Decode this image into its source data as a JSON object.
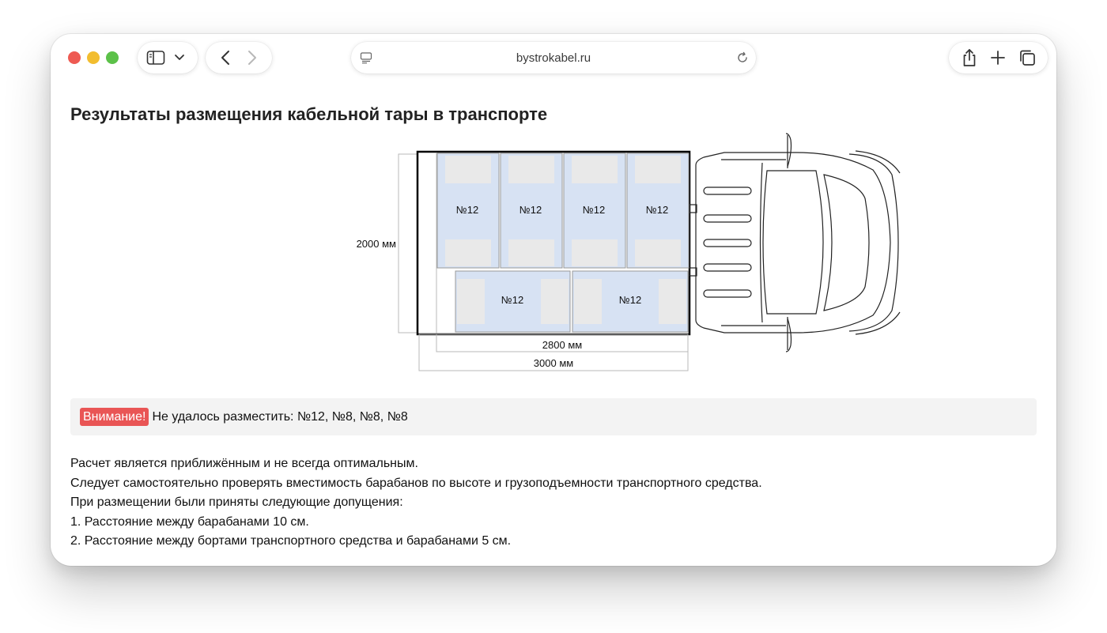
{
  "browser": {
    "url": "bystrokabel.ru"
  },
  "page": {
    "title": "Результаты размещения кабельной тары в транспорте"
  },
  "diagram": {
    "drum_label": "№12",
    "width_label": "2000 мм",
    "bed_length_label": "2800 мм",
    "total_length_label": "3000 мм",
    "drum_fill_color": "#d7e2f3",
    "flange_color": "#e9e9e9"
  },
  "warning": {
    "badge": "Внимание!",
    "text": "Не удалось разместить: №12, №8, №8, №8",
    "badge_color": "#e95555"
  },
  "notes": {
    "lines": [
      "Расчет является приближённым и не всегда оптимальным.",
      "Следует самостоятельно проверять вместимость барабанов по высоте и грузоподъемности транспортного средства.",
      "При размещении были приняты следующие допущения:",
      "1. Расстояние между барабанами 10 см.",
      "2. Расстояние между бортами транспортного средства и барабанами 5 см."
    ]
  }
}
